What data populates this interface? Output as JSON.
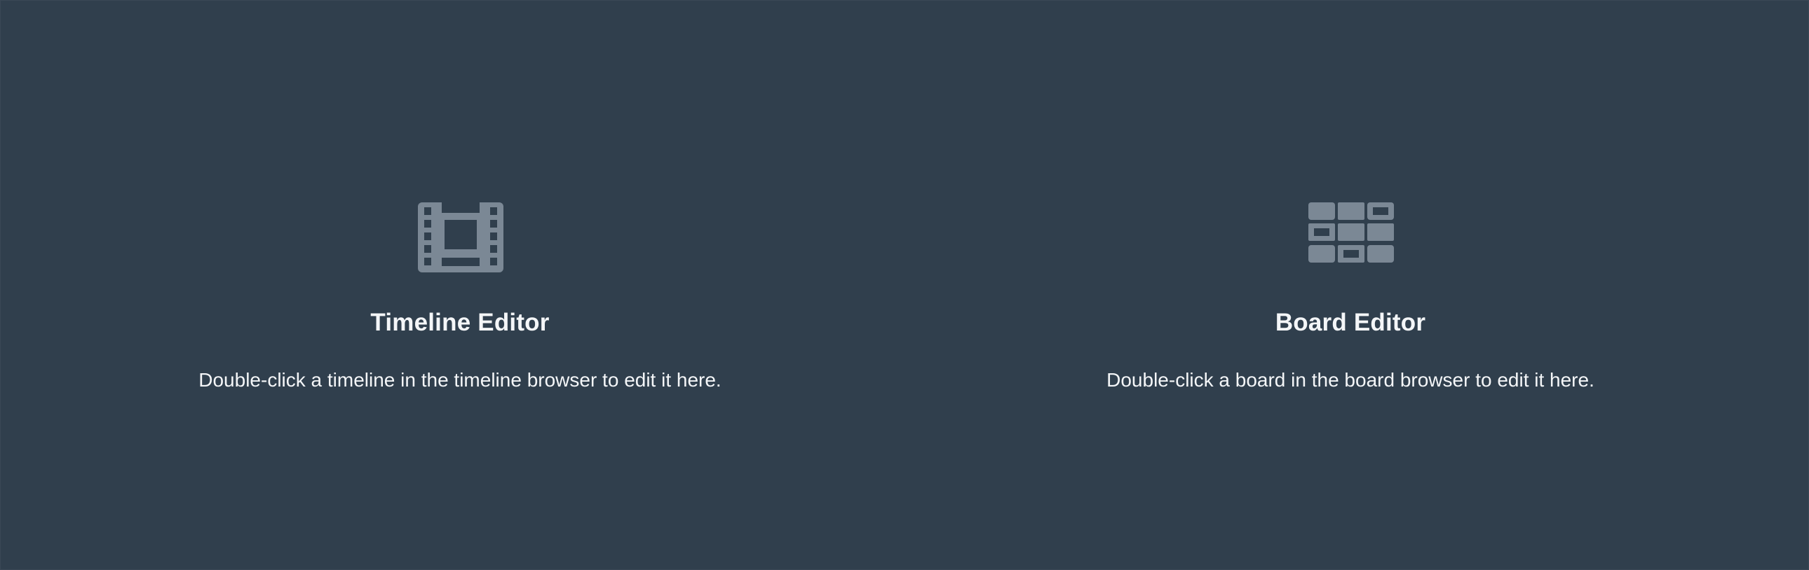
{
  "timeline_editor": {
    "icon": "film-icon",
    "title": "Timeline Editor",
    "description": "Double-click a timeline in the timeline browser to edit it here."
  },
  "board_editor": {
    "icon": "board-grid-icon",
    "title": "Board Editor",
    "description": "Double-click a board in the board browser to edit it here."
  },
  "colors": {
    "background": "#303f4d",
    "icon": "#7b8895",
    "text": "#f4f6f8"
  }
}
